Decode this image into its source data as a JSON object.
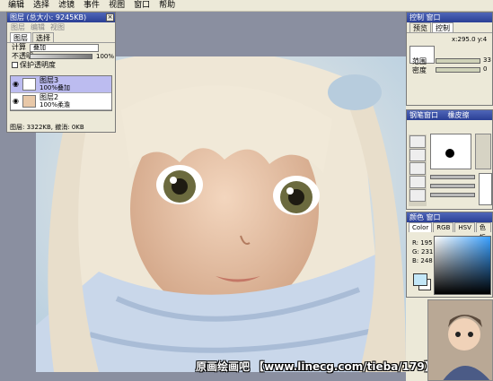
{
  "menu": [
    "编辑",
    "选择",
    "滤镜",
    "事件",
    "视图",
    "窗口",
    "帮助"
  ],
  "layers_panel": {
    "title": "图层 (总大小: 9245KB)",
    "sub_menu": [
      "图层",
      "编辑",
      "视图"
    ],
    "tabs": [
      "图层",
      "选择"
    ],
    "mode_label": "计算",
    "mode_value": "叠加",
    "opacity_label": "不透明",
    "opacity_value": "100%",
    "preserve_label": "保护透明度",
    "layers": [
      {
        "name": "图层3",
        "mode": "100%叠加"
      },
      {
        "name": "图层2",
        "mode": "100%柔澹"
      }
    ],
    "status": "图层: 3322KB, 撤消: 0KB"
  },
  "control_panel": {
    "title": "控制 窗口",
    "tabs": [
      "预览",
      "控制"
    ],
    "coords": "x:295.0 y:4",
    "zoom_label": "范围",
    "zoom_value": "33",
    "angle_label": "密度",
    "angle_value": "0"
  },
  "brush_panel": {
    "title": "钢笔窗口",
    "tab2": "橡皮擦"
  },
  "color_panel": {
    "title": "颜色 窗口",
    "tabs": [
      "Color",
      "RGB",
      "HSV",
      "色板"
    ],
    "r": "R: 195",
    "g": "G: 231",
    "b": "B: 248"
  },
  "canvas": {
    "watermark": "原画绘画吧  【www.linecg.com/tieba/179】"
  },
  "colors": {
    "title_bar": "#2a3f95",
    "selected_layer": "#bcbcf0",
    "foreground": "#c3e7f8"
  }
}
